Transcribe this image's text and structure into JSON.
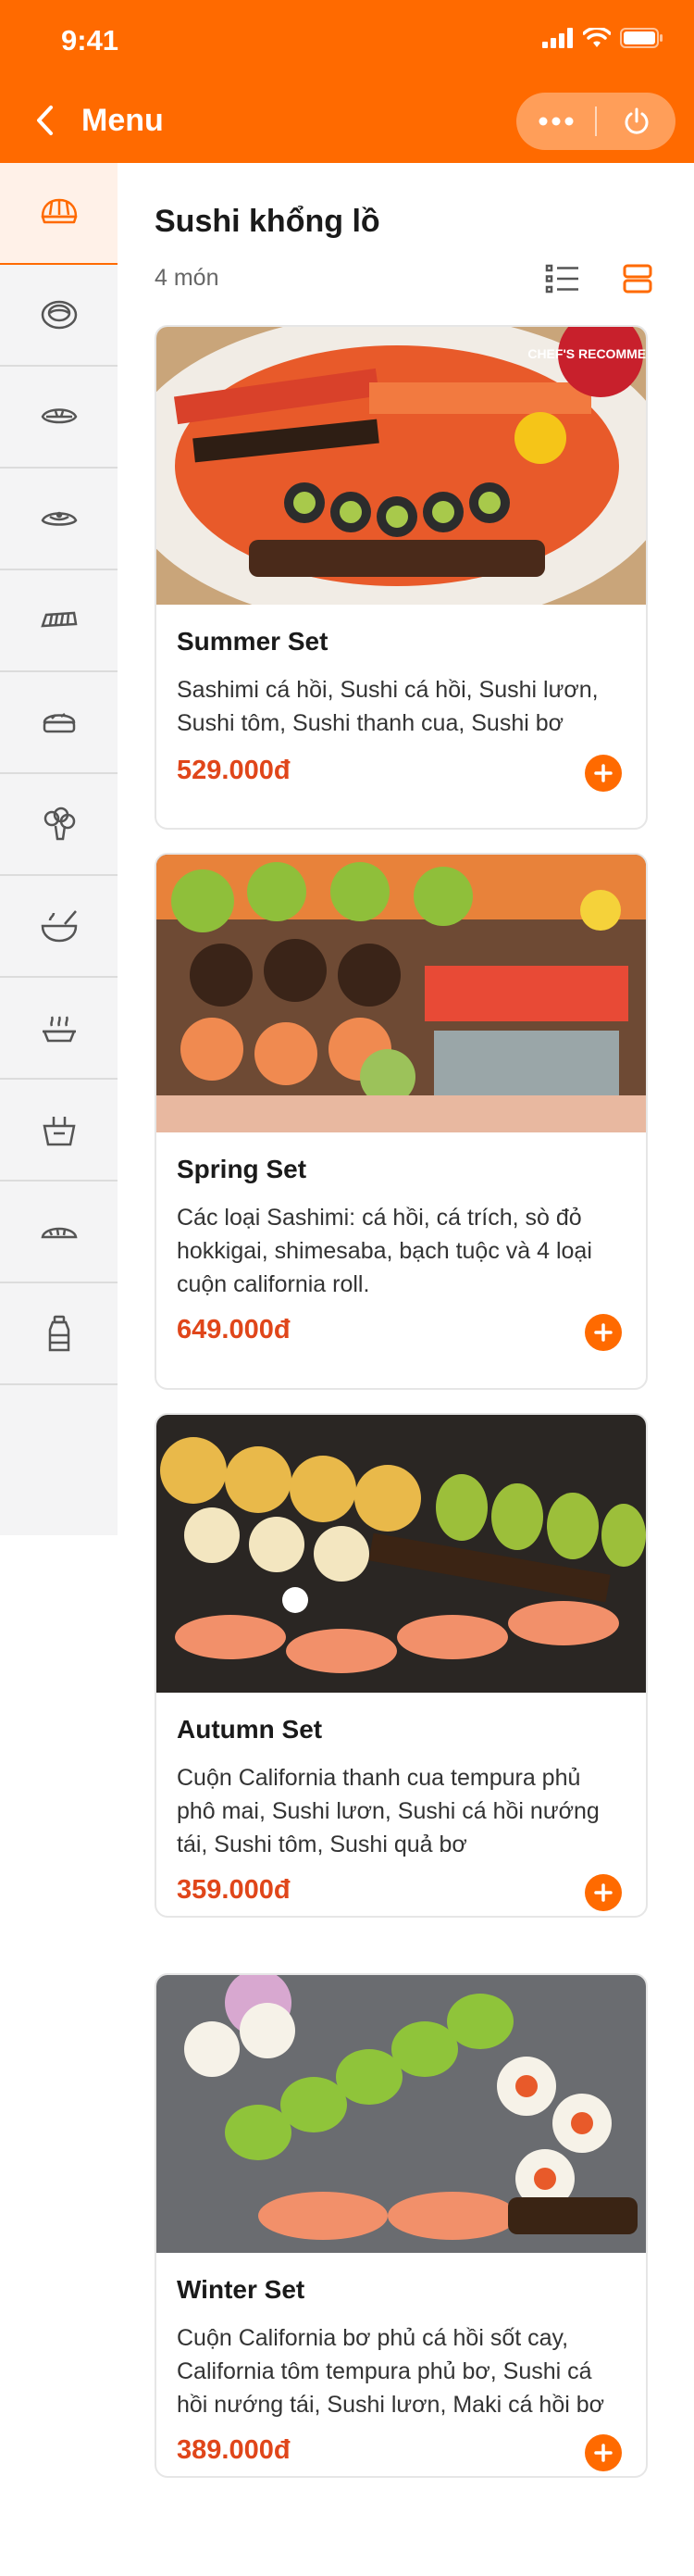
{
  "status_bar": {
    "time": "9:41"
  },
  "header": {
    "title": "Menu"
  },
  "category": {
    "title": "Sushi khổng lồ",
    "count": "4 món"
  },
  "sidebar_icons": [
    "sushi-icon",
    "roll-icon",
    "nigiri-icon",
    "nigiri-2-icon",
    "fish-icon",
    "bento-icon",
    "broccoli-icon",
    "soup-bowl-icon",
    "hot-food-icon",
    "takeout-box-icon",
    "dumpling-icon",
    "bottle-icon"
  ],
  "items": [
    {
      "name": "Summer Set",
      "desc": "Sashimi cá hồi, Sushi cá hồi, Sushi lươn, Sushi tôm, Sushi thanh cua, Sushi bơ",
      "price": "529.000đ",
      "badge": "CHEF'S RECOMMENDS"
    },
    {
      "name": "Spring Set",
      "desc": "Các loại Sashimi: cá hồi, cá trích, sò đỏ hokkigai, shimesaba, bạch tuộc và 4 loại cuộn california roll.",
      "price": "649.000đ"
    },
    {
      "name": "Autumn Set",
      "desc": "Cuộn California thanh cua tempura phủ phô mai, Sushi lươn, Sushi cá hồi nướng tái, Sushi tôm, Sushi quả bơ",
      "price": "359.000đ"
    },
    {
      "name": "Winter Set",
      "desc": "Cuộn California bơ phủ cá hồi sốt cay, California tôm tempura phủ bơ, Sushi cá hồi nướng tái, Sushi lươn, Maki cá hồi bơ",
      "price": "389.000đ"
    }
  ],
  "colors": {
    "primary": "#FF6A00",
    "price": "#E0461A",
    "sidebar_bg": "#F4F4F5"
  }
}
